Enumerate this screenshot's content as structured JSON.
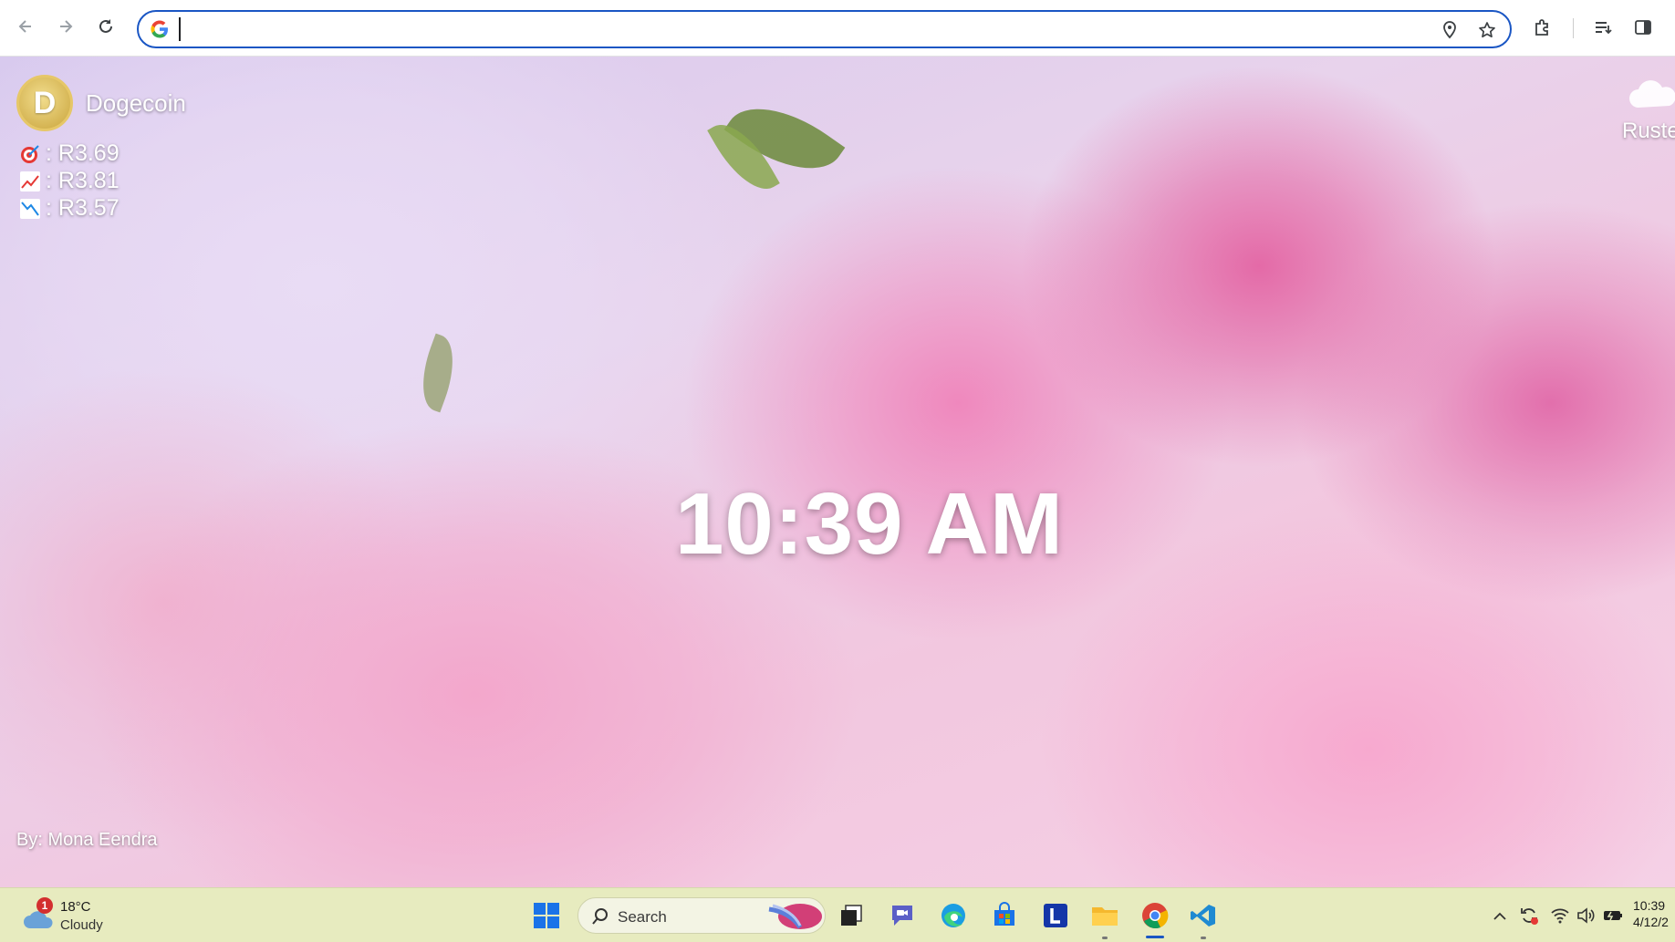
{
  "browser": {
    "address_value": "",
    "icons": [
      "back-icon",
      "forward-icon",
      "reload-icon",
      "google-icon",
      "location-icon",
      "star-icon",
      "extensions-icon",
      "reading-list-icon",
      "side-panel-icon"
    ]
  },
  "crypto": {
    "name": "Dogecoin",
    "logo_letter": "D",
    "current": ": R3.69",
    "high": ": R3.81",
    "low": ": R3.57"
  },
  "weather_widget": {
    "location": "Ruste"
  },
  "clock": {
    "time": "10:39 AM"
  },
  "credit": {
    "text": "By: Mona Eendra"
  },
  "taskbar": {
    "weather_temp": "18°C",
    "weather_condition": "Cloudy",
    "weather_badge": "1",
    "search_label": "Search",
    "apps": [
      "start-icon",
      "task-view-icon",
      "teams-chat-icon",
      "edge-icon",
      "store-icon",
      "l-app-icon",
      "file-explorer-icon",
      "chrome-icon",
      "vscode-icon"
    ],
    "system_time": "10:39",
    "system_date": "4/12/2"
  },
  "colors": {
    "accent": "#1a56c4",
    "taskbar_bg": "#e7ebbf",
    "clock_text": "#ffffff"
  }
}
